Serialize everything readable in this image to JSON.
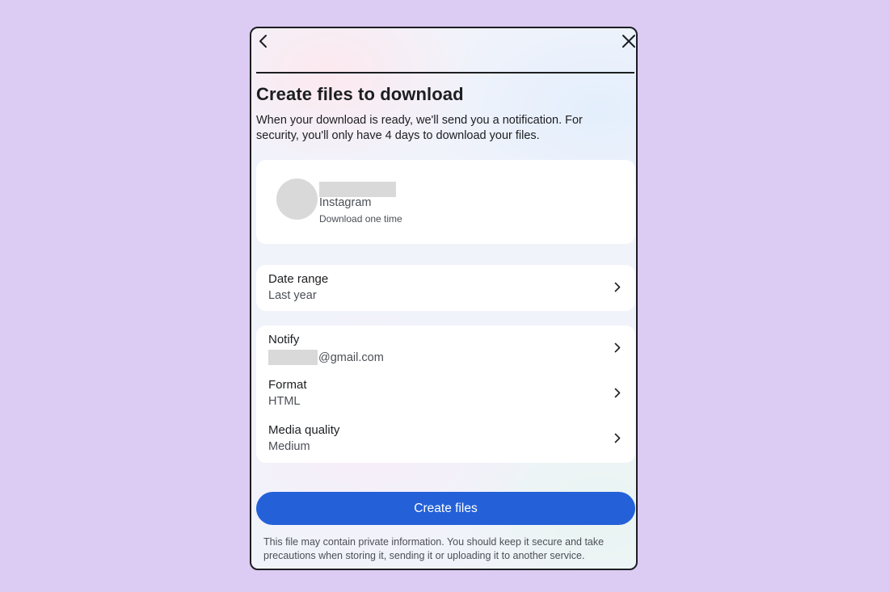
{
  "header": {
    "back_icon": "chevron-left-icon",
    "close_icon": "close-icon"
  },
  "title": "Create files to download",
  "description": "When your download is ready, we'll send you a notification. For security, you'll only have 4 days to download your files.",
  "account": {
    "service": "Instagram",
    "frequency": "Download one time"
  },
  "date_range": {
    "label": "Date range",
    "value": "Last year"
  },
  "settings": {
    "notify": {
      "label": "Notify",
      "value_suffix": "@gmail.com"
    },
    "format": {
      "label": "Format",
      "value": "HTML"
    },
    "media_quality": {
      "label": "Media quality",
      "value": "Medium"
    }
  },
  "primary_button": "Create files",
  "footnote": "This file may contain private information. You should keep it secure and take precautions when storing it, sending it or uploading it to another service.",
  "colors": {
    "page_background": "#dccbf3",
    "primary": "#2461d8",
    "redaction": "#d9d9d9"
  }
}
